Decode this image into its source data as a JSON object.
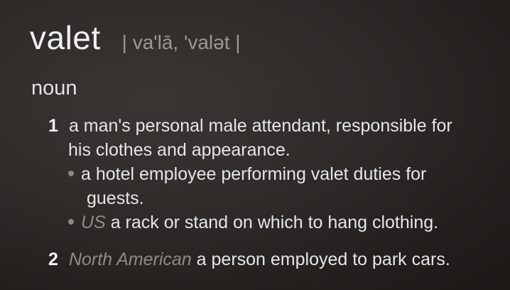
{
  "entry": {
    "headword": "valet",
    "pronunciation": "| va'lā, 'valət |",
    "part_of_speech": "noun",
    "senses": [
      {
        "number": "1",
        "line1": "a man's personal male attendant, responsible for",
        "line2": "his clothes and appearance.",
        "subsenses": [
          {
            "line1": "a hotel employee performing valet duties for",
            "line2": "guests."
          },
          {
            "label": "US",
            "text": "a rack or stand on which to hang clothing."
          }
        ]
      },
      {
        "number": "2",
        "label": "North American",
        "text": "a person employed to park cars."
      }
    ]
  }
}
